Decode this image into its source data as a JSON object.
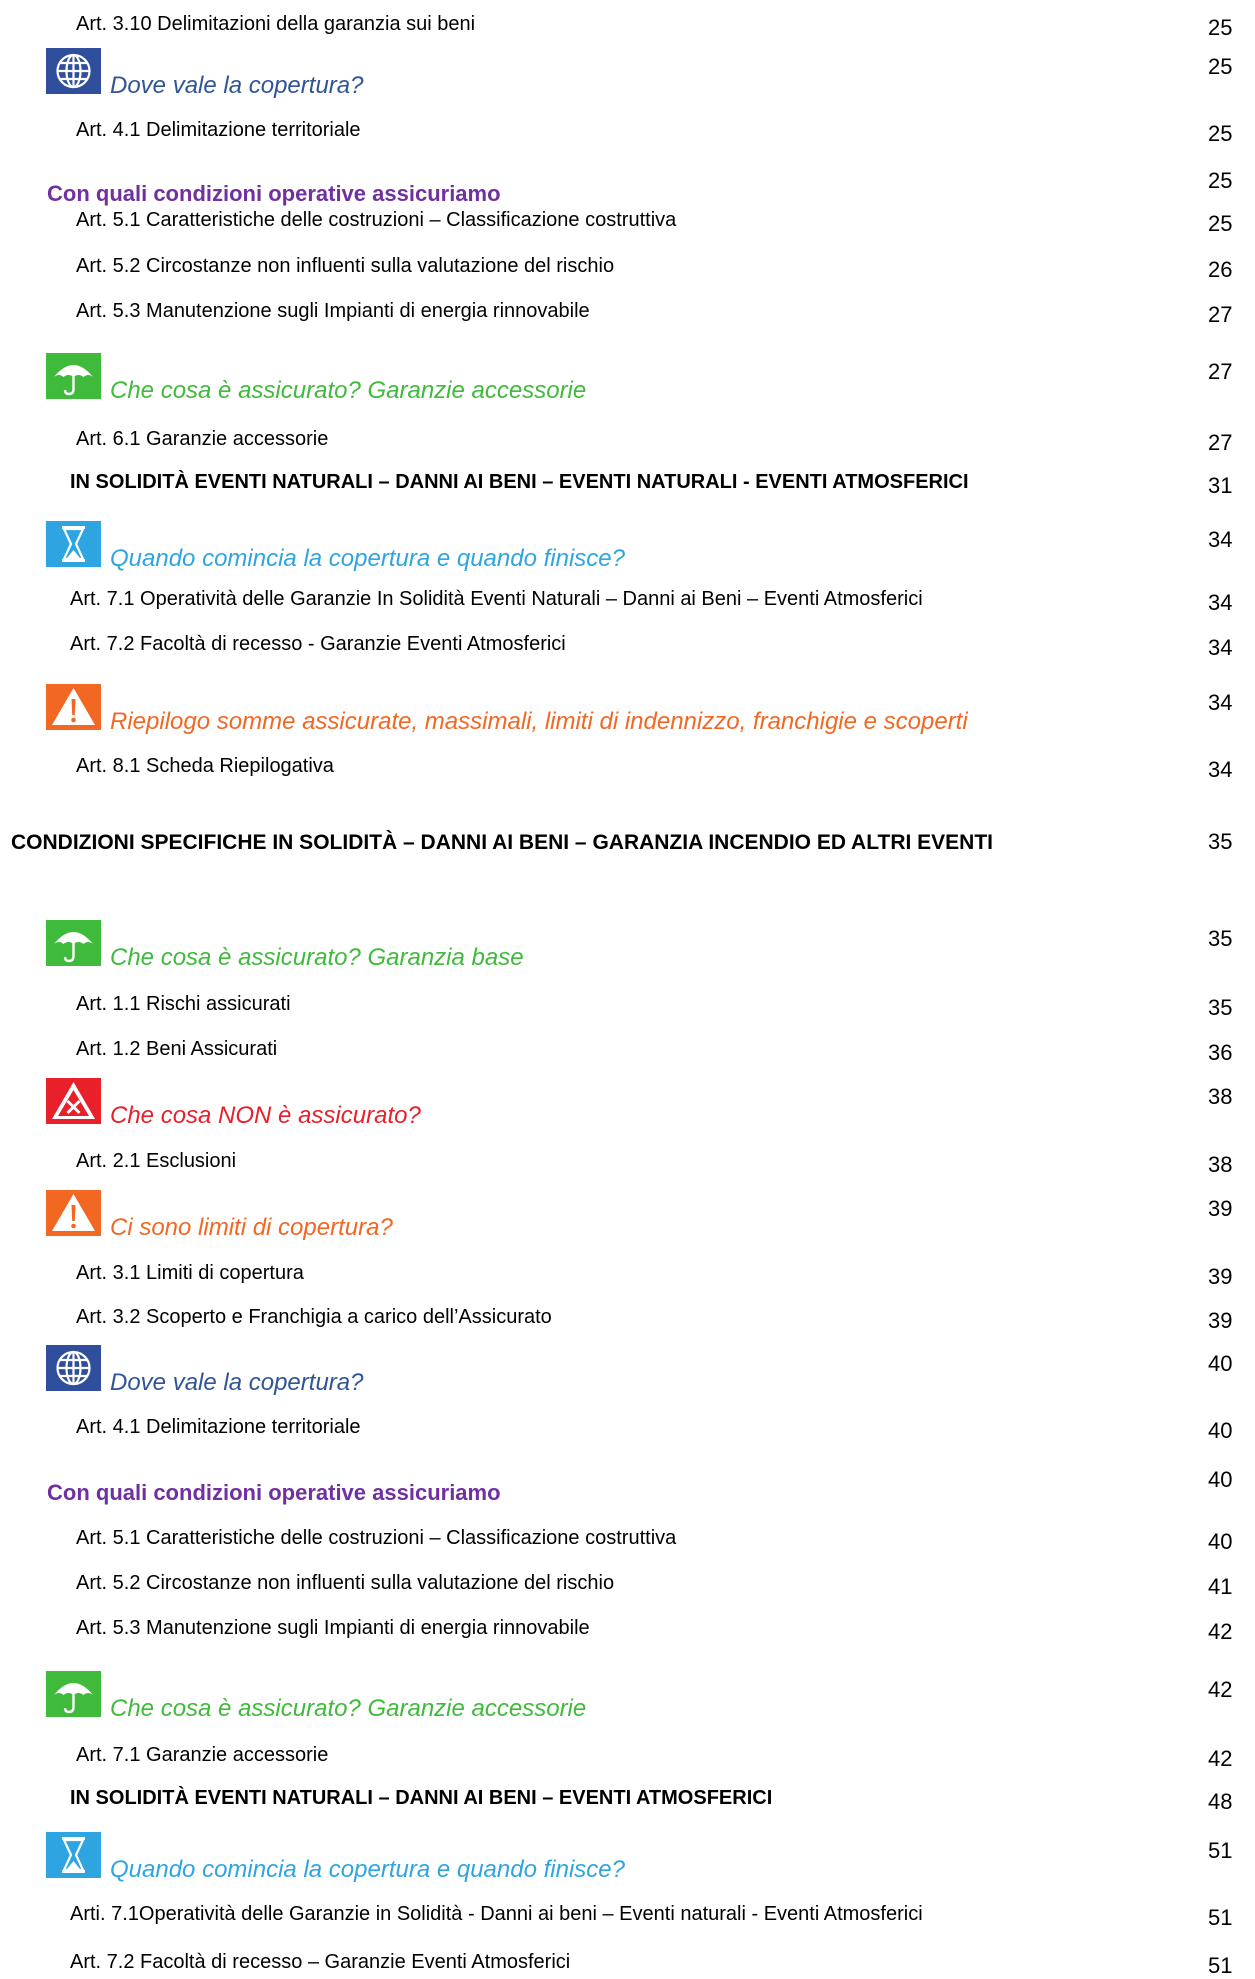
{
  "rows": [
    {
      "kind": "art",
      "text": "Art. 3.10 Delimitazioni della garanzia sui beni",
      "page": "25"
    },
    {
      "kind": "icon",
      "icon": "globe-icon",
      "text": "Dove vale la copertura?",
      "page": "25"
    },
    {
      "kind": "art",
      "text": "Art. 4.1 Delimitazione territoriale",
      "page": "25"
    },
    {
      "kind": "purple",
      "text": "Con quali condizioni operative assicuriamo",
      "page": "25"
    },
    {
      "kind": "art",
      "text": "Art. 5.1 Caratteristiche delle costruzioni – Classificazione costruttiva",
      "page": "25"
    },
    {
      "kind": "art",
      "text": "Art. 5.2 Circostanze non influenti sulla valutazione del rischio",
      "page": "26"
    },
    {
      "kind": "art",
      "text": "Art. 5.3 Manutenzione sugli Impianti di energia rinnovabile",
      "page": "27"
    },
    {
      "kind": "icon",
      "icon": "umbrella-icon",
      "text": "Che cosa è assicurato? Garanzie accessorie",
      "page": "27"
    },
    {
      "kind": "art",
      "text": "Art. 6.1 Garanzie accessorie",
      "page": "27"
    },
    {
      "kind": "caps",
      "text": "IN SOLIDITÀ EVENTI NATURALI – DANNI AI BENI – EVENTI NATURALI - EVENTI ATMOSFERICI",
      "page": "31"
    },
    {
      "kind": "icon",
      "icon": "hourglass-icon",
      "text": "Quando comincia la copertura e quando finisce?",
      "page": "34"
    },
    {
      "kind": "art2",
      "text": "Art. 7.1 Operatività delle Garanzie In Solidità Eventi Naturali – Danni ai Beni – Eventi Atmosferici",
      "page": "34"
    },
    {
      "kind": "art2",
      "text": "Art. 7.2 Facoltà di recesso - Garanzie Eventi Atmosferici",
      "page": "34"
    },
    {
      "kind": "icon",
      "icon": "warning-icon",
      "text": "Riepilogo somme assicurate, massimali, limiti di indennizzo, franchigie e scoperti",
      "page": "34"
    },
    {
      "kind": "art",
      "text": "Art. 8.1 Scheda Riepilogativa",
      "page": "34"
    },
    {
      "kind": "hdr",
      "text": "CONDIZIONI SPECIFICHE IN SOLIDITÀ – DANNI AI BENI – GARANZIA INCENDIO ED ALTRI EVENTI",
      "page": "35"
    },
    {
      "kind": "icon",
      "icon": "umbrella-icon",
      "text": "Che cosa è assicurato? Garanzia base",
      "page": "35"
    },
    {
      "kind": "art",
      "text": "Art. 1.1 Rischi assicurati",
      "page": "35"
    },
    {
      "kind": "art",
      "text": "Art. 1.2 Beni Assicurati",
      "page": "36"
    },
    {
      "kind": "icon",
      "icon": "excluded-icon",
      "text": "Che cosa NON è assicurato?",
      "page": "38"
    },
    {
      "kind": "art",
      "text": "Art. 2.1 Esclusioni",
      "page": "38"
    },
    {
      "kind": "icon",
      "icon": "warning-icon",
      "text": "Ci sono limiti di copertura?",
      "page": "39"
    },
    {
      "kind": "art",
      "text": "Art. 3.1 Limiti di copertura",
      "page": "39"
    },
    {
      "kind": "art",
      "text": "Art. 3.2 Scoperto e Franchigia a carico dell’Assicurato",
      "page": "39"
    },
    {
      "kind": "icon",
      "icon": "globe-icon",
      "text": "Dove vale la copertura?",
      "page": "40"
    },
    {
      "kind": "art",
      "text": "Art. 4.1 Delimitazione territoriale",
      "page": "40"
    },
    {
      "kind": "purple",
      "text": "Con quali condizioni operative assicuriamo",
      "page": "40"
    },
    {
      "kind": "art",
      "text": "Art. 5.1 Caratteristiche delle costruzioni – Classificazione costruttiva",
      "page": "40"
    },
    {
      "kind": "art",
      "text": "Art. 5.2 Circostanze non influenti sulla valutazione del rischio",
      "page": "41"
    },
    {
      "kind": "art",
      "text": "Art. 5.3 Manutenzione sugli Impianti di energia rinnovabile",
      "page": "42"
    },
    {
      "kind": "icon",
      "icon": "umbrella-icon",
      "text": "Che cosa è assicurato? Garanzie accessorie",
      "page": "42"
    },
    {
      "kind": "art",
      "text": "Art. 7.1 Garanzie accessorie",
      "page": "42"
    },
    {
      "kind": "caps",
      "text": "IN SOLIDITÀ EVENTI NATURALI – DANNI AI BENI – EVENTI ATMOSFERICI",
      "page": "48"
    },
    {
      "kind": "icon",
      "icon": "hourglass-icon",
      "text": "Quando comincia la copertura e quando finisce?",
      "page": "51"
    },
    {
      "kind": "art2",
      "text": "Arti. 7.1Operatività delle Garanzie in Solidità  - Danni ai beni – Eventi naturali - Eventi Atmosferici",
      "page": "51"
    },
    {
      "kind": "art2",
      "text": "Art. 7.2 Facoltà di recesso – Garanzie  Eventi Atmosferici",
      "page": "51"
    }
  ],
  "colors": {
    "blue_icon": "#2f4f9d",
    "green_icon": "#3fba3b",
    "sky_icon": "#2ea5e0",
    "orange_icon": "#f26722",
    "red_icon": "#e8202a",
    "purple_heading": "#7030a0"
  }
}
